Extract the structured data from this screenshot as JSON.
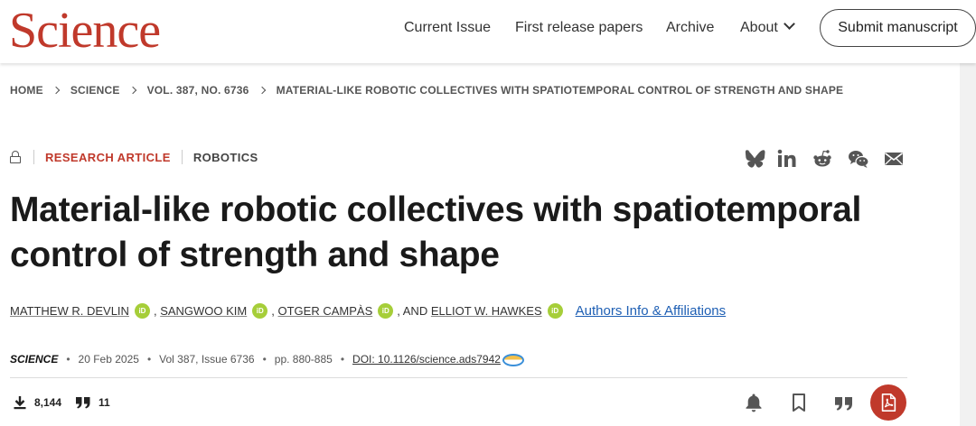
{
  "header": {
    "logo": "Science",
    "nav": [
      {
        "label": "Current Issue"
      },
      {
        "label": "First release papers"
      },
      {
        "label": "Archive"
      },
      {
        "label": "About"
      }
    ],
    "submit_label": "Submit manuscript"
  },
  "breadcrumb": [
    "HOME",
    "SCIENCE",
    "VOL. 387, NO. 6736",
    "MATERIAL-LIKE ROBOTIC COLLECTIVES WITH SPATIOTEMPORAL CONTROL OF STRENGTH AND SHAPE"
  ],
  "article": {
    "type_label": "RESEARCH ARTICLE",
    "subject": "ROBOTICS",
    "title_line1": "Material-like robotic collectives with spatiotemporal",
    "title_line2": "control of strength and shape",
    "authors": [
      {
        "name": "MATTHEW R. DEVLIN",
        "after": ","
      },
      {
        "name": "SANGWOO KIM",
        "after": ","
      },
      {
        "name": "OTGER CAMPÀS",
        "after": ", AND"
      },
      {
        "name": "ELLIOT W. HAWKES",
        "after": ""
      }
    ],
    "orcid_label": "iD",
    "affiliations_link": "Authors Info & Affiliations",
    "journal": "SCIENCE",
    "date": "20 Feb 2025",
    "volume": "Vol 387, Issue 6736",
    "pages": "pp. 880-885",
    "doi": "DOI: 10.1126/science.ads7942"
  },
  "metrics": {
    "downloads": "8,144",
    "citations": "11"
  },
  "share_icons": [
    "bluesky-icon",
    "linkedin-icon",
    "reddit-icon",
    "wechat-icon",
    "email-icon"
  ],
  "tool_icons": [
    "bell-icon",
    "bookmark-icon",
    "quote-icon",
    "pdf-icon"
  ],
  "colors": {
    "brand_red": "#c0392b",
    "link_blue": "#1e5fb4",
    "orcid_green": "#a6ce39"
  }
}
